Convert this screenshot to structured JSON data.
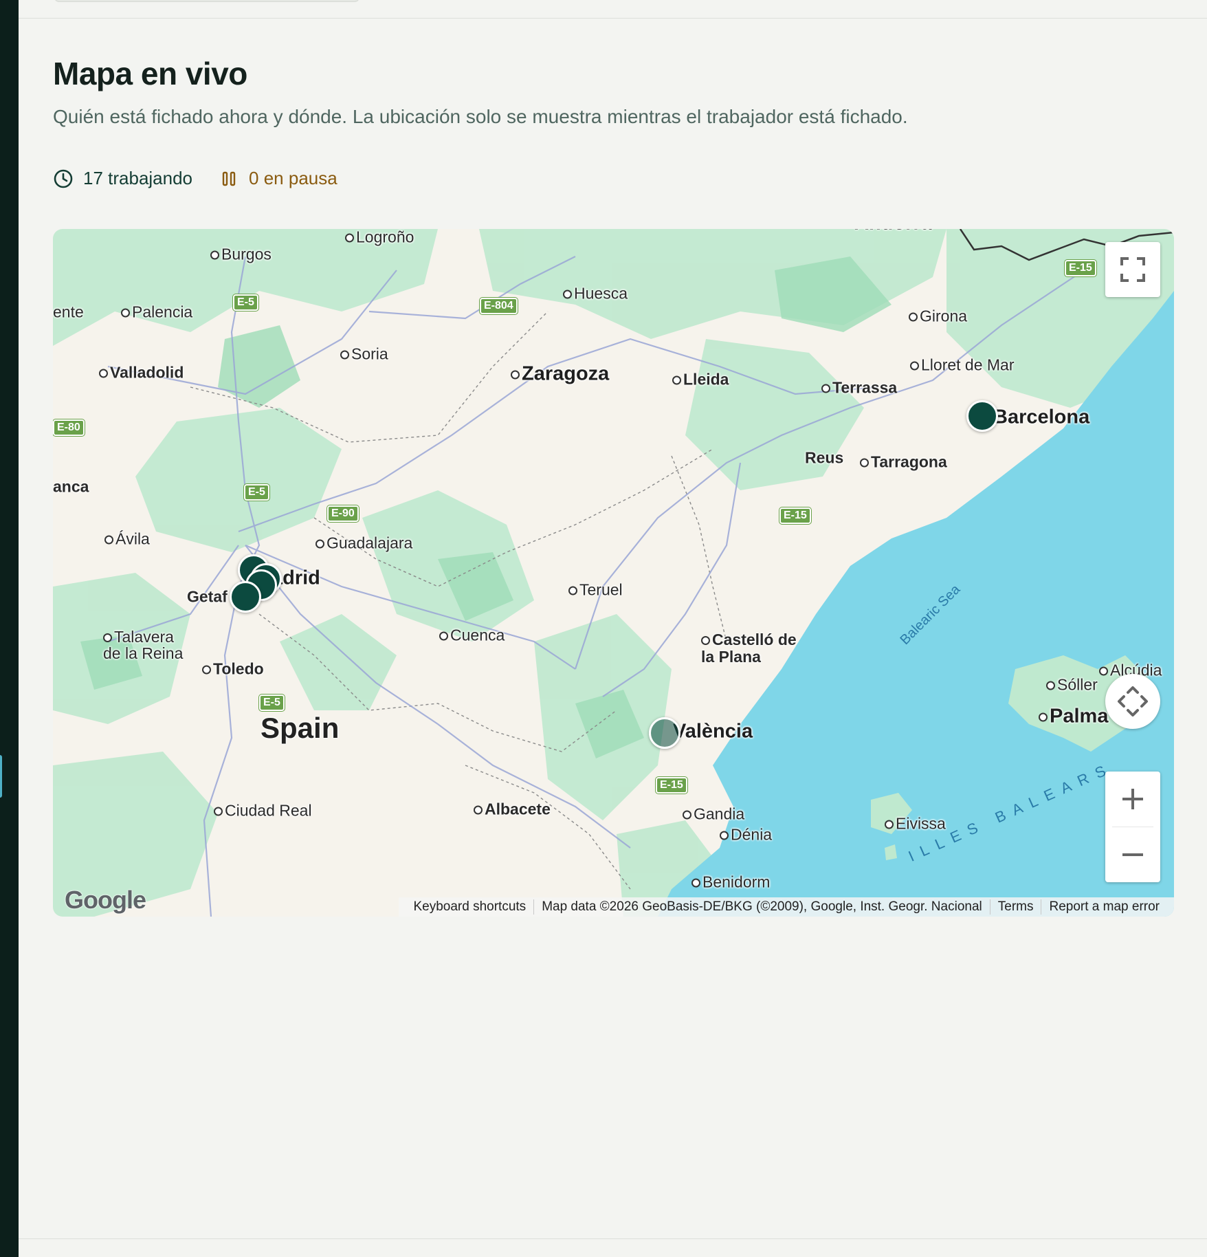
{
  "header": {
    "title": "Mapa en vivo",
    "subtitle": "Quién está fichado ahora y dónde. La ubicación solo se muestra mientras el trabajador está fichado."
  },
  "stats": {
    "working": "17 trabajando",
    "paused": "0 en pausa"
  },
  "map": {
    "cities": {
      "logrono": "Logroño",
      "burgos": "Burgos",
      "huesca": "Huesca",
      "palencia": "Palencia",
      "ente": "ente",
      "girona": "Girona",
      "soria": "Soria",
      "valladolid": "Valladolid",
      "zaragoza": "Zaragoza",
      "lleida": "Lleida",
      "lloret": "Lloret de Mar",
      "terrassa": "Terrassa",
      "barcelona": "Barcelona",
      "reus": "Reus",
      "tarragona": "Tarragona",
      "anca": "anca",
      "avila": "Ávila",
      "guadalajara": "Guadalajara",
      "madrid": "adrid",
      "getafe": "Getaf",
      "teruel": "Teruel",
      "talavera": "Talavera de la Reina",
      "toledo": "Toledo",
      "cuenca": "Cuenca",
      "castello": "Castelló de la Plana",
      "alcudia": "Alcúdia",
      "soller": "Sóller",
      "palma": "Palma",
      "spain": "Spain",
      "valencia": "València",
      "ciudad_real": "Ciudad Real",
      "albacete": "Albacete",
      "gandia": "Gandia",
      "eivissa": "Eivissa",
      "denia": "Dénia",
      "benidorm": "Benidorm",
      "andorra": "Andorra"
    },
    "sea": "Balearic Sea",
    "islands": "ILLES BALEARS",
    "roads": {
      "e5a": "E-5",
      "e804": "E-804",
      "e15a": "E-15",
      "e80": "E-80",
      "e5b": "E-5",
      "e90": "E-90",
      "e15b": "E-15",
      "e5c": "E-5",
      "e15c": "E-15"
    },
    "attribution": {
      "keyboard": "Keyboard shortcuts",
      "data": "Map data ©2026 GeoBasis-DE/BKG (©2009), Google, Inst. Geogr. Nacional",
      "terms": "Terms",
      "report": "Report a map error"
    },
    "google_logo": "Google",
    "colors": {
      "pin": "#0c4a3f",
      "sea": "#7fd6e8",
      "land": "#f6f3ec",
      "vegetation": "#b7e6c9"
    }
  }
}
